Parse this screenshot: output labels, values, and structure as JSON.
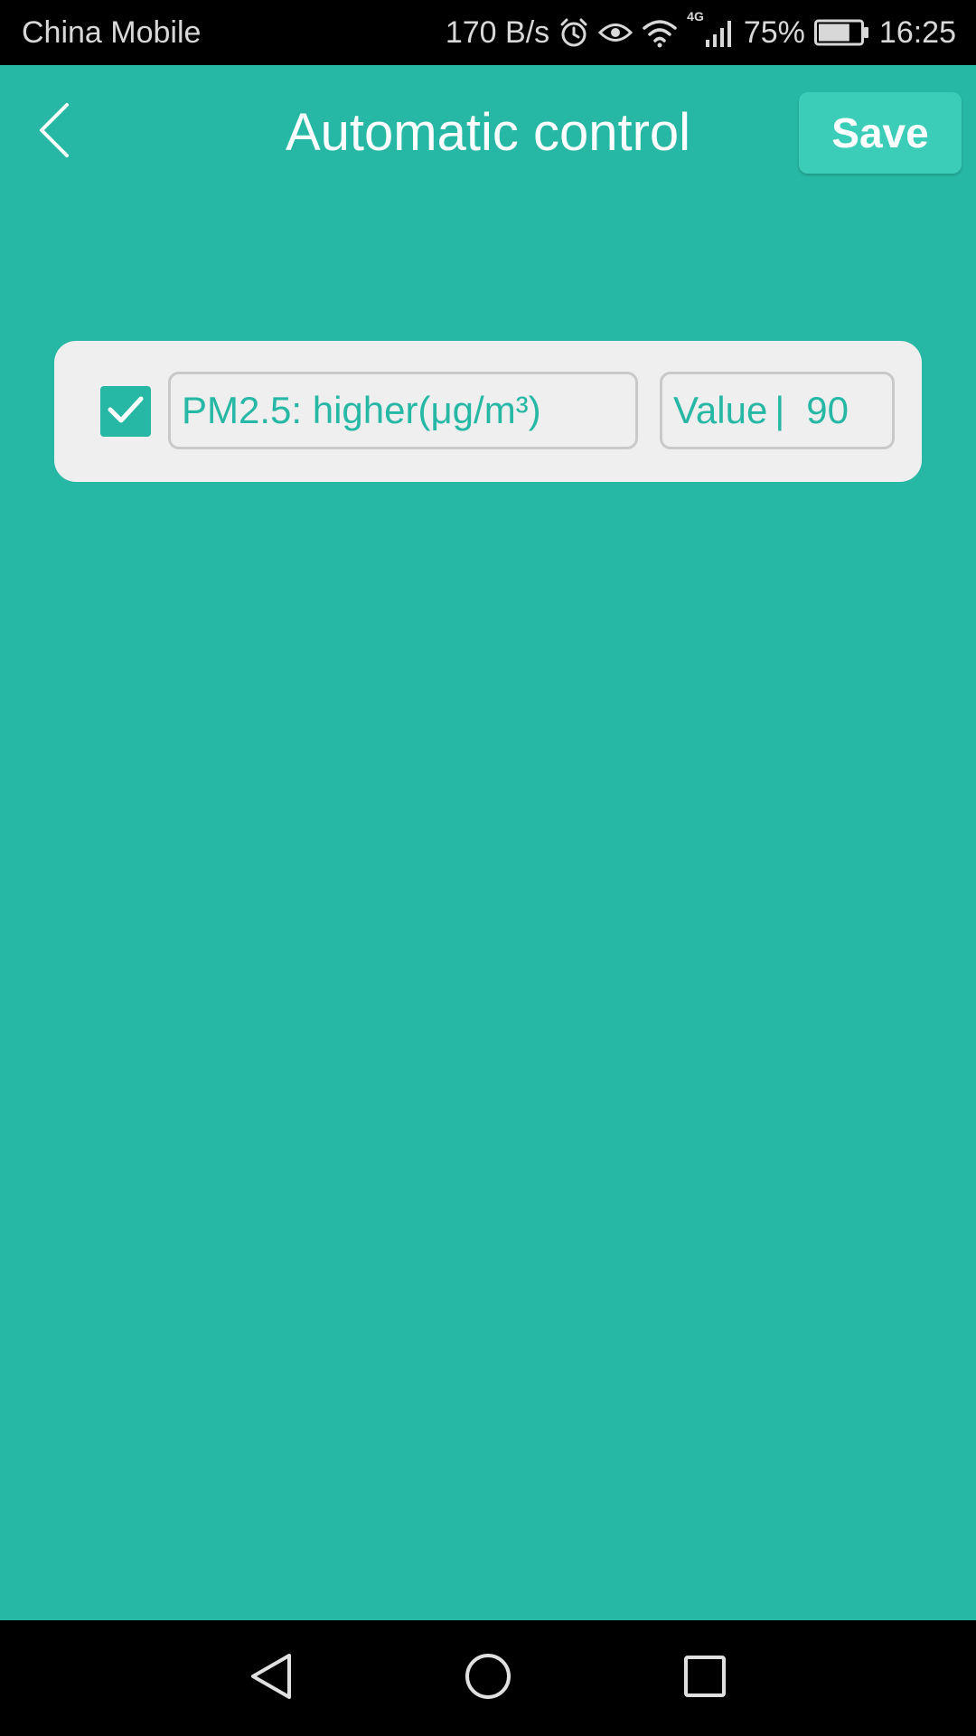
{
  "status_bar": {
    "carrier": "China Mobile",
    "speed": "170 B/s",
    "network": "4G",
    "battery_percent": "75%",
    "battery_level": 0.75,
    "time": "16:25",
    "icons": [
      "alarm-icon",
      "eye-icon",
      "wifi-icon",
      "signal-icon",
      "battery-icon"
    ]
  },
  "header": {
    "title": "Automatic control",
    "save_label": "Save",
    "back_icon": "chevron-left-icon"
  },
  "condition": {
    "checked": true,
    "field_label": "PM2.5: higher(μg/m³)",
    "value_label": "Value",
    "value_separator": "|",
    "value": "90"
  },
  "nav_bar": {
    "icons": [
      "nav-back-icon",
      "nav-home-icon",
      "nav-recents-icon"
    ]
  },
  "colors": {
    "background": "#27b8a5",
    "save_button": "#3ccdb8",
    "card": "#efefef",
    "accent": "#27b8a5"
  }
}
